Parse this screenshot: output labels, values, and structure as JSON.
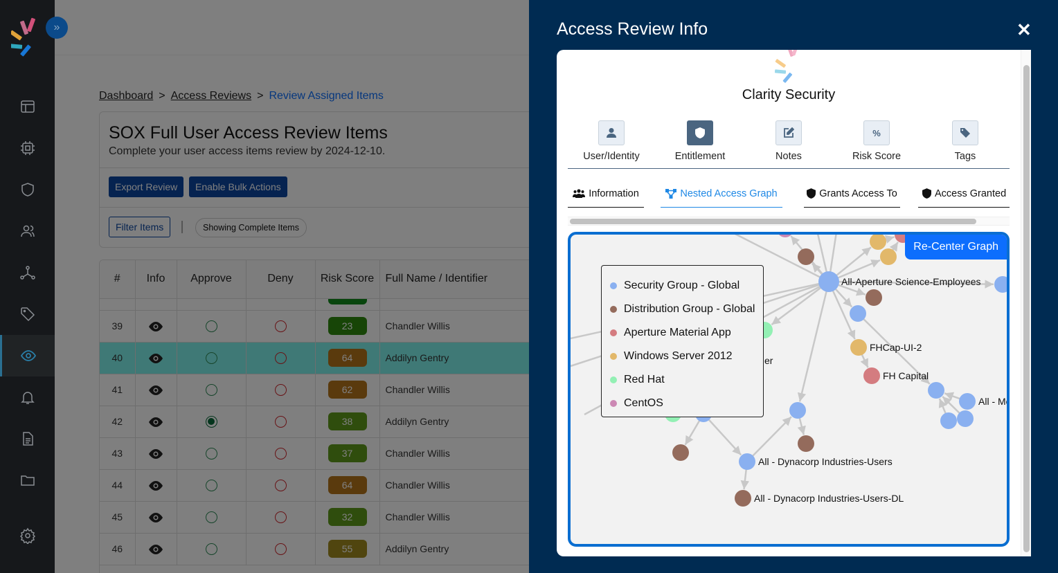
{
  "sidebar": {
    "expand_icon": "chevrons-right-icon",
    "items": [
      {
        "name": "dashboard",
        "icon": "layout-icon"
      },
      {
        "name": "applications",
        "icon": "chip-icon"
      },
      {
        "name": "entitlements",
        "icon": "shield-icon"
      },
      {
        "name": "identities",
        "icon": "users-icon"
      },
      {
        "name": "graph",
        "icon": "network-icon"
      },
      {
        "name": "tags",
        "icon": "tag-icon"
      },
      {
        "name": "reviews",
        "icon": "eye-icon",
        "active": true
      },
      {
        "name": "notifications",
        "icon": "bell-icon"
      },
      {
        "name": "reports",
        "icon": "document-icon"
      },
      {
        "name": "files",
        "icon": "folder-icon"
      },
      {
        "name": "settings",
        "icon": "gear-icon"
      }
    ]
  },
  "breadcrumb": {
    "items": [
      "Dashboard",
      "Access Reviews"
    ],
    "separator": ">",
    "current": "Review Assigned Items"
  },
  "review": {
    "title": "SOX Full User Access Review Items",
    "subtitle": "Complete your user access items review by 2024-12-10.",
    "export_label": "Export Review",
    "bulk_label": "Enable Bulk Actions",
    "filter_label": "Filter Items",
    "showing_label": "Showing Complete Items"
  },
  "table": {
    "columns": [
      "#",
      "Info",
      "Approve",
      "Deny",
      "Risk Score",
      "Full Name / Identifier"
    ],
    "rows": [
      {
        "num": "39",
        "approve": false,
        "risk": "23",
        "risk_color": "#2e8b0e",
        "name": "Chandler Willis",
        "selected": false
      },
      {
        "num": "40",
        "approve": false,
        "risk": "64",
        "risk_color": "#b5741a",
        "name": "Addilyn Gentry",
        "selected": true
      },
      {
        "num": "41",
        "approve": false,
        "risk": "62",
        "risk_color": "#b5741a",
        "name": "Chandler Willis",
        "selected": false
      },
      {
        "num": "42",
        "approve": true,
        "risk": "38",
        "risk_color": "#5f9a1a",
        "name": "Addilyn Gentry",
        "selected": false
      },
      {
        "num": "43",
        "approve": false,
        "risk": "37",
        "risk_color": "#5f9a1a",
        "name": "Chandler Willis",
        "selected": false
      },
      {
        "num": "44",
        "approve": false,
        "risk": "64",
        "risk_color": "#b5741a",
        "name": "Chandler Willis",
        "selected": false
      },
      {
        "num": "45",
        "approve": false,
        "risk": "32",
        "risk_color": "#5f9a1a",
        "name": "Chandler Willis",
        "selected": false
      },
      {
        "num": "46",
        "approve": false,
        "risk": "55",
        "risk_color": "#a08a1f",
        "name": "Addilyn Gentry",
        "selected": false
      }
    ]
  },
  "drawer": {
    "title": "Access Review Info",
    "close_label": "✕",
    "brand": "Clarity Security",
    "categories": [
      {
        "label": "User/Identity",
        "icon": "user-icon",
        "active": false
      },
      {
        "label": "Entitlement",
        "icon": "shield-icon",
        "active": true
      },
      {
        "label": "Notes",
        "icon": "edit-icon",
        "active": false
      },
      {
        "label": "Risk Score",
        "icon": "percent-icon",
        "active": false
      },
      {
        "label": "Tags",
        "icon": "tag-icon",
        "active": false
      }
    ],
    "subtabs": [
      {
        "label": "Information",
        "icon": "users-icon",
        "active": false
      },
      {
        "label": "Nested Access Graph",
        "icon": "graph-icon",
        "active": true
      },
      {
        "label": "Grants Access To",
        "icon": "shield-icon",
        "active": false
      },
      {
        "label": "Access Granted I",
        "icon": "shield-icon",
        "active": false
      }
    ],
    "recenter_label": "Re-Center Graph",
    "legend": [
      {
        "label": "Security Group - Global",
        "color": "#8ab0f0"
      },
      {
        "label": "Distribution Group - Global",
        "color": "#946b5c"
      },
      {
        "label": "Aperture Material App",
        "color": "#d47c80"
      },
      {
        "label": "Windows Server 2012",
        "color": "#e2b86a"
      },
      {
        "label": "Red Hat",
        "color": "#93f0b4"
      },
      {
        "label": "CentOS",
        "color": "#cc88b4"
      }
    ],
    "graph_labels": {
      "hub": "All-Aperture Science-Employees",
      "fhcap": "FHCap-UI-2",
      "fhcapital": "FH Capital",
      "allme": "All - Me",
      "dyn_users": "All - Dynacorp Industries-Users",
      "dyn_dl": "All - Dynacorp Industries-Users-DL",
      "partial_er": "er"
    }
  }
}
